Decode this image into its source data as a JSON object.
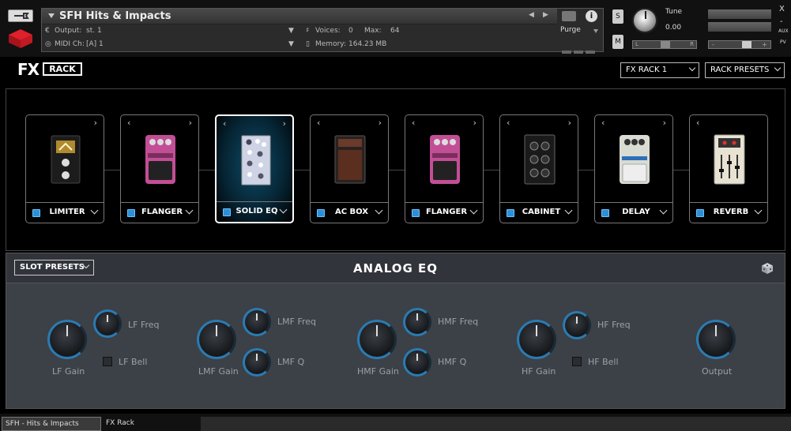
{
  "header": {
    "instrument_name": "SFH Hits & Impacts",
    "output_label": "Output:",
    "output_value": "st. 1",
    "midi_label": "MIDI Ch:",
    "midi_value": "[A]  1",
    "voices_label": "Voices:",
    "voices_value": "0",
    "max_label": "Max:",
    "max_value": "64",
    "memory_label": "Memory:",
    "memory_value": "164.23 MB",
    "purge_label": "Purge",
    "solo_label": "S",
    "mute_label": "M",
    "tune_label": "Tune",
    "tune_value": "0.00",
    "pan_left": "L",
    "pan_right": "R",
    "vol_minus": "-",
    "vol_plus": "+",
    "close_glyph": "X",
    "minimize_glyph": "-",
    "aux_label": "AUX",
    "pv_label": "PV"
  },
  "fxbar": {
    "logo_fx": "FX",
    "logo_rack": "RACK",
    "rack_select": "FX RACK 1",
    "rack_presets": "RACK PRESETS"
  },
  "slots": [
    {
      "name": "LIMITER",
      "has_prev": false,
      "selected": false
    },
    {
      "name": "FLANGER",
      "has_prev": true,
      "selected": false
    },
    {
      "name": "SOLID EQ",
      "has_prev": true,
      "selected": true
    },
    {
      "name": "AC BOX",
      "has_prev": true,
      "selected": false
    },
    {
      "name": "FLANGER",
      "has_prev": true,
      "selected": false
    },
    {
      "name": "CABINET",
      "has_prev": true,
      "selected": false
    },
    {
      "name": "DELAY",
      "has_prev": true,
      "selected": false
    },
    {
      "name": "REVERB",
      "has_prev": true,
      "selected": false
    }
  ],
  "eq": {
    "slot_presets": "SLOT PRESETS",
    "title": "ANALOG EQ",
    "lf_gain": "LF Gain",
    "lf_freq": "LF Freq",
    "lf_bell": "LF Bell",
    "lmf_gain": "LMF Gain",
    "lmf_freq": "LMF Freq",
    "lmf_q": "LMF Q",
    "hmf_gain": "HMF Gain",
    "hmf_freq": "HMF Freq",
    "hmf_q": "HMF Q",
    "hf_gain": "HF Gain",
    "hf_freq": "HF Freq",
    "hf_bell": "HF Bell",
    "output": "Output"
  },
  "tabs": {
    "tab1": "SFH - Hits & Impacts",
    "tab2": "FX Rack"
  },
  "colors": {
    "accent_blue": "#2a7bb2",
    "power_blue": "#2d8fd6",
    "panel_grey": "#3c4047"
  }
}
